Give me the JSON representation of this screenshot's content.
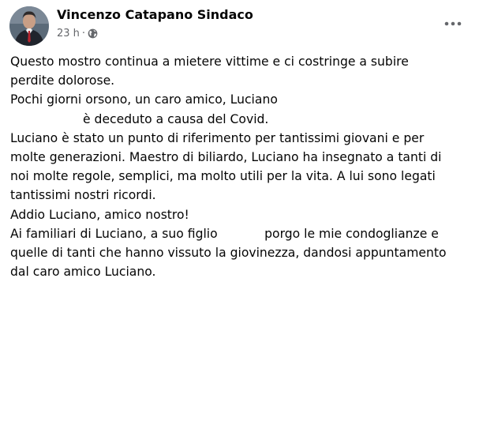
{
  "post": {
    "author": "Vincenzo Catapano Sindaco",
    "time": "23 h",
    "separator": "·",
    "audience_icon": "globe-icon",
    "more_icon": "more-options-icon",
    "lines": [
      "Questo mostro continua a mietere vittime e ci costringe a subire",
      "perdite dolorose.",
      "Pochi giorni orsono, un caro amico, Luciano",
      "è deceduto a causa del Covid.",
      "Luciano è stato un punto di riferimento per tantissimi giovani e per",
      "molte generazioni. Maestro di biliardo, Luciano ha insegnato a tanti di",
      "noi molte regole, semplici, ma molto utili per la vita. A lui sono legati",
      "tantissimi nostri ricordi.",
      "Addio Luciano, amico nostro!",
      "Ai familiari di Luciano, a suo figlio            porgo le mie condoglianze e",
      "quelle di tanti che hanno vissuto la giovinezza, dandosi appuntamento",
      "dal caro amico Luciano."
    ]
  },
  "colors": {
    "text": "#050505",
    "secondary": "#65676b",
    "background": "#ffffff"
  }
}
